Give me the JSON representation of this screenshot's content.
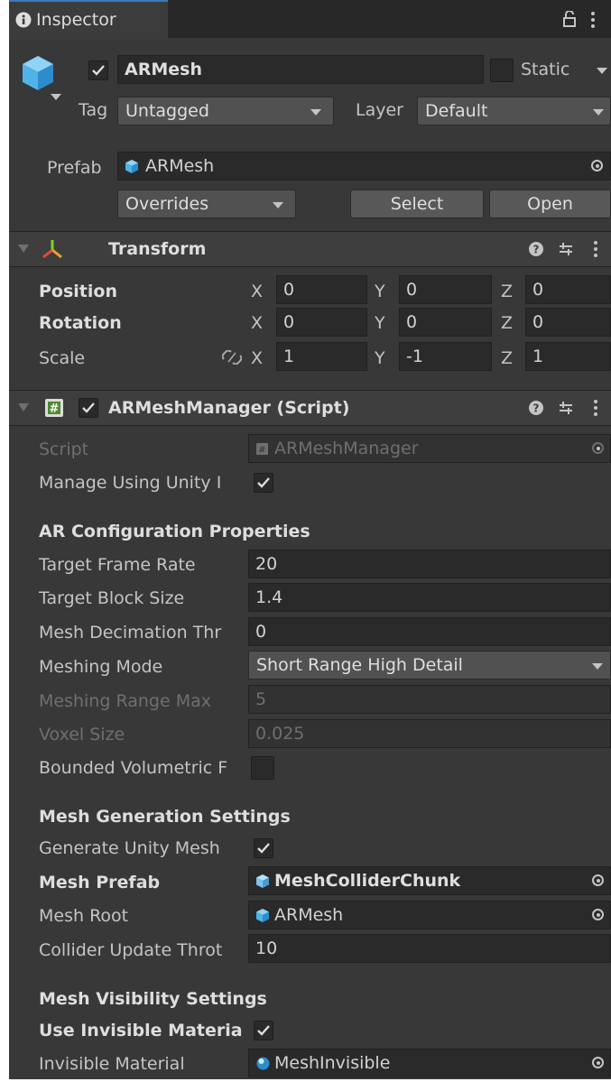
{
  "tab": {
    "title": "Inspector"
  },
  "gameobject": {
    "name": "ARMesh",
    "static_label": "Static",
    "tag_label": "Tag",
    "tag_value": "Untagged",
    "layer_label": "Layer",
    "layer_value": "Default"
  },
  "prefab": {
    "label": "Prefab",
    "value": "ARMesh",
    "overrides": "Overrides",
    "select": "Select",
    "open": "Open"
  },
  "transform": {
    "title": "Transform",
    "rows": [
      {
        "label": "Position",
        "x": "0",
        "y": "0",
        "z": "0"
      },
      {
        "label": "Rotation",
        "x": "0",
        "y": "0",
        "z": "0"
      },
      {
        "label": "Scale",
        "x": "1",
        "y": "-1",
        "z": "1"
      }
    ],
    "axes": {
      "x": "X",
      "y": "Y",
      "z": "Z"
    }
  },
  "script": {
    "title": "ARMeshManager (Script)",
    "script_label": "Script",
    "script_value": "ARMeshManager",
    "manage_label": "Manage Using Unity I",
    "section_ar": "AR Configuration Properties",
    "target_frame_rate_label": "Target Frame Rate",
    "target_frame_rate": "20",
    "target_block_size_label": "Target Block Size",
    "target_block_size": "1.4",
    "mesh_decimation_label": "Mesh Decimation Thr",
    "mesh_decimation": "0",
    "meshing_mode_label": "Meshing Mode",
    "meshing_mode": "Short Range High Detail",
    "meshing_range_label": "Meshing Range Max",
    "meshing_range": "5",
    "voxel_size_label": "Voxel Size",
    "voxel_size": "0.025",
    "bounded_label": "Bounded Volumetric F",
    "section_mesh_gen": "Mesh Generation Settings",
    "generate_label": "Generate Unity Mesh",
    "mesh_prefab_label": "Mesh Prefab",
    "mesh_prefab": "MeshColliderChunk",
    "mesh_root_label": "Mesh Root",
    "mesh_root": "ARMesh",
    "collider_label": "Collider Update Throt",
    "collider_value": "10",
    "section_visibility": "Mesh Visibility Settings",
    "use_invisible_label": "Use Invisible Materia",
    "invisible_material_label": "Invisible Material",
    "invisible_material": "MeshInvisible"
  },
  "colors": {
    "accent": "#3a79bb",
    "panel": "#383838",
    "field": "#2a2a2a",
    "cube": "#4fb3e8"
  }
}
